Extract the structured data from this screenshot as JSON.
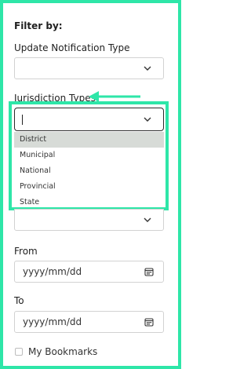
{
  "filter": {
    "heading": "Filter by:",
    "update_notification_type": {
      "label": "Update Notification Type",
      "value": ""
    },
    "jurisdiction_types": {
      "label": "Jurisdiction Types",
      "value": "",
      "options": [
        "District",
        "Municipal",
        "National",
        "Provincial",
        "State"
      ],
      "highlighted_option": "District"
    },
    "third_select": {
      "value": ""
    },
    "from": {
      "label": "From",
      "placeholder": "yyyy/mm/dd"
    },
    "to": {
      "label": "To",
      "placeholder": "yyyy/mm/dd"
    },
    "my_bookmarks": {
      "label": "My Bookmarks",
      "checked": false
    }
  },
  "icons": {
    "chevron": "chevron-down-icon",
    "calendar": "calendar-icon",
    "annotation_arrow": "arrow-left-icon"
  },
  "colors": {
    "annotation_accent": "#2ee6a8",
    "option_highlight": "#d7dbd7",
    "input_border": "#d2d2d2",
    "focus_border": "#2b2b2b"
  }
}
